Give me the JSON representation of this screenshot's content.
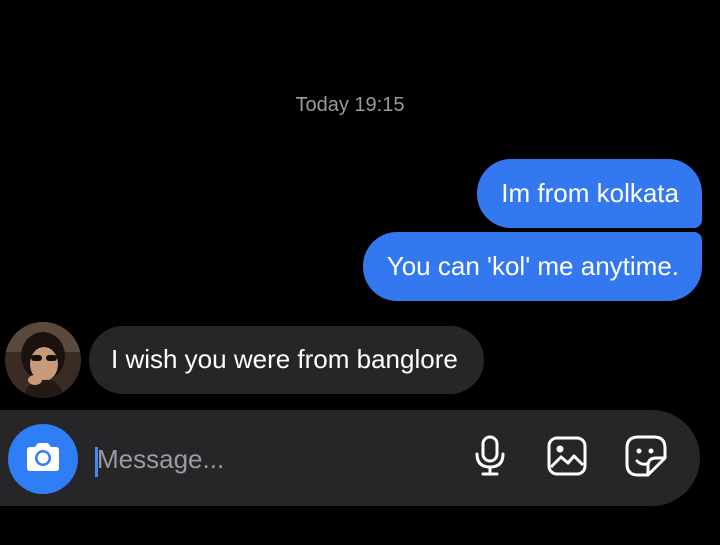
{
  "thread": {
    "timestamp": "Today 19:15",
    "messages": [
      {
        "direction": "outgoing",
        "text": "Im from kolkata"
      },
      {
        "direction": "outgoing",
        "text": "You can 'kol' me anytime."
      },
      {
        "direction": "incoming",
        "text": "I wish you were from banglore"
      }
    ]
  },
  "composer": {
    "placeholder": "Message...",
    "value": "",
    "camera_icon": "camera-icon",
    "tools": [
      {
        "icon": "microphone-icon"
      },
      {
        "icon": "gallery-icon"
      },
      {
        "icon": "sticker-icon"
      }
    ]
  },
  "colors": {
    "background": "#000000",
    "outgoing_bubble": "#3478f0",
    "incoming_bubble": "#262629",
    "composer": "#262629",
    "camera_button": "#2f7ef6",
    "muted_text": "#9a9a9f"
  }
}
